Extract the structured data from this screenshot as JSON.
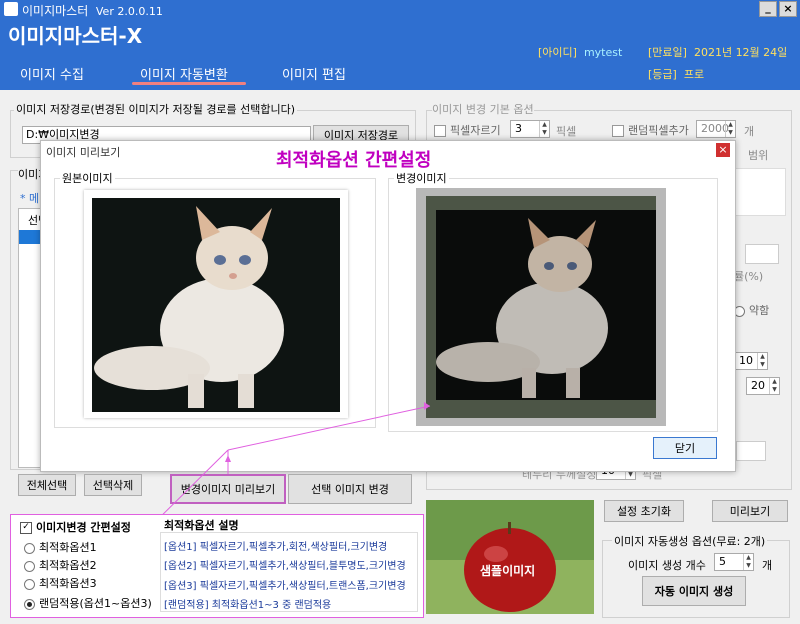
{
  "app": {
    "title": "이미지마스터",
    "version": "Ver 2.0.0.11",
    "brand": "이미지마스터-X"
  },
  "user": {
    "id_label": "[아이디]",
    "id_value": "mytest",
    "expire_label": "[만료일]",
    "expire_value": "2021년 12월 24일",
    "grade_label": "[등급]",
    "grade_value": "프로"
  },
  "nav": {
    "tabs": [
      {
        "label": "이미지 수집"
      },
      {
        "label": "이미지 자동변환",
        "active": true
      },
      {
        "label": "이미지 편집"
      }
    ]
  },
  "save": {
    "label": "이미지 저장경로(변경된 이미지가 저장될 경로를 선택합니다)",
    "path": "D:₩이미지변경",
    "button": "이미지 저장경로"
  },
  "left_list": {
    "header": "이미지",
    "meta": "* 메터",
    "col": "선택"
  },
  "options": {
    "title": "이미지 변경 기본 옵션",
    "pixel_crop": "픽셀자르기",
    "pixel_crop_value": "3",
    "pixel_unit": "픽셀",
    "random_pixel": "랜덤픽셀추가",
    "random_pixel_value": "2000",
    "random_unit": "개",
    "range_suffix": "범위",
    "percent_suffix": "률(%)",
    "weak": "약함",
    "val1": "10",
    "val2": "20",
    "border_label": "테두리 두께설정",
    "border_value": "10",
    "border_unit": "픽셀"
  },
  "preview": {
    "title": "이미지 미리보기",
    "heading": "최적화옵션 간편설정",
    "original_label": "원본이미지",
    "changed_label": "변경이미지",
    "close": "닫기",
    "close_x": "×"
  },
  "buttons": {
    "select_all": "전체선택",
    "delete_selected": "선택삭제",
    "preview_changed": "변경이미지 미리보기",
    "change_selected": "선택 이미지 변경",
    "reset": "설정 초기화",
    "preview": "미리보기",
    "auto_generate": "자동 이미지 생성"
  },
  "easy": {
    "title": "이미지변경 간편설정",
    "options": [
      {
        "label": "최적화옵션1",
        "checked": false
      },
      {
        "label": "최적화옵션2",
        "checked": false
      },
      {
        "label": "최적화옵션3",
        "checked": false
      },
      {
        "label": "랜덤적용(옵션1~옵션3)",
        "checked": true
      }
    ]
  },
  "desc": {
    "title": "최적화옵션 설명",
    "lines": [
      "[옵션1] 픽셀자르기,픽셀추가,회전,색상필터,크기변경",
      "[옵션2] 픽셀자르기,픽셀추가,색상필터,블투명도,크기변경",
      "[옵션3] 픽셀자르기,픽셀추가,색상필터,트랜스폼,크기변경",
      "[랜덤적용] 최적화옵션1~3 중 랜덤적용"
    ]
  },
  "sample": {
    "label": "샘플이미지"
  },
  "auto": {
    "title": "이미지 자동생성 옵션(무료: 2개)",
    "count_label": "이미지 생성 개수",
    "count_value": "5",
    "count_unit": "개"
  },
  "colors": {
    "header": "#2f6fd0",
    "accent_text": "#c000c0",
    "magenta_line": "#e060e0"
  }
}
